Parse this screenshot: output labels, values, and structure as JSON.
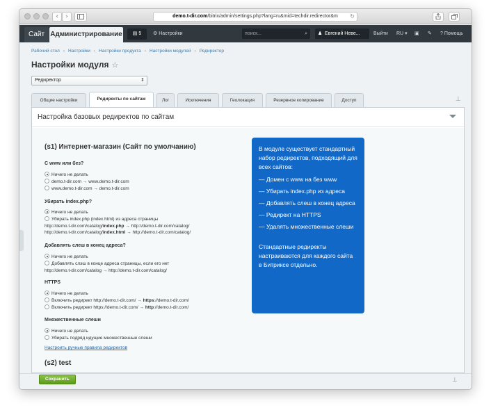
{
  "browser": {
    "url_domain": "demo.t-dir.com",
    "url_path": "/bitrix/admin/settings.php?lang=ru&mid=techdir.redirector&m",
    "back_glyph": "‹",
    "forward_glyph": "›"
  },
  "adminbar": {
    "site_tab": "Сайт",
    "admin_tab": "Администрирование",
    "notifications_count": "5",
    "settings_label": "Настройки",
    "search_placeholder": "поиск...",
    "user_name": "Евгений Неве...",
    "logout_label": "Выйти",
    "lang_label": "RU",
    "help_label": "Помощь"
  },
  "breadcrumbs": [
    "Рабочий стол",
    "Настройки",
    "Настройки продукта",
    "Настройки модулей",
    "Редиректор"
  ],
  "page_title": "Настройки модуля",
  "module_select": {
    "value": "Редиректор"
  },
  "tabs": [
    {
      "label": "Общие настройки",
      "active": false
    },
    {
      "label": "Редиректы по сайтам",
      "active": true
    },
    {
      "label": "Лог",
      "active": false
    },
    {
      "label": "Исключения",
      "active": false
    },
    {
      "label": "Геолокация",
      "active": false
    },
    {
      "label": "Резервное копирование",
      "active": false
    },
    {
      "label": "Доступ",
      "active": false
    }
  ],
  "panel": {
    "title": "Настройка базовых редиректов по сайтам",
    "s1_title": "(s1) Интернет-магазин (Сайт по умолчанию)",
    "groups": {
      "www": {
        "question": "С www или без?",
        "opt1": "Ничего не делать",
        "opt2": "demo.t-dir.com → www.demo.t-dir.com",
        "opt3": "www.demo.t-dir.com → demo.t-dir.com"
      },
      "index": {
        "question": "Убирать index.php?",
        "opt1": "Ничего не делать",
        "opt2": "Убирать index.php (index.html) из адреса страницы",
        "ex1_a": "http://demo.t-dir.com/catalog/",
        "ex1_b": "index.php",
        "ex1_c": " → http://demo.t-dir.com/catalog/",
        "ex2_a": "http://demo.t-dir.com/catalog/",
        "ex2_b": "index.html",
        "ex2_c": " → http://demo.t-dir.com/catalog/"
      },
      "slash": {
        "question": "Добавлять слеш в конец адреса?",
        "opt1": "Ничего не делать",
        "opt2": "Добавлять слэш в конце адреса страницы, если его нет",
        "example": "http://demo.t-dir.com/catalog → http://demo.t-dir.com/catalog/"
      },
      "https": {
        "question": "HTTPS",
        "opt1": "Ничего не делать",
        "opt2_a": "Включить редирект http://demo.t-dir.com/ → ",
        "opt2_b": "https",
        "opt2_c": "://demo.t-dir.com/",
        "opt3_a": "Включить редирект https://demo.t-dir.com/ → ",
        "opt3_b": "http",
        "opt3_c": "://demo.t-dir.com/"
      },
      "slashes": {
        "question": "Множественные слеши",
        "opt1": "Ничего не делать",
        "opt2": "Убирать подряд идущие множественные слеши"
      }
    },
    "manual_link": "Настроить ручные правила редиректов",
    "s2_title": "(s2) test"
  },
  "callout": {
    "intro": "В модуле существует стандартный набор редиректов, подходящий для всех сайтов:",
    "items": [
      "— Домен с www на без www",
      "— Убирать index.php из адреса",
      "— Добавлять слеш в конец адреса",
      "— Редирект на HTTPS",
      "— Удалять множественные слеши"
    ],
    "outro": "Стандартные редиректы настраиваются для каждого сайта в Битриксе отдельно."
  },
  "footer": {
    "save_label": "Сохранить"
  }
}
